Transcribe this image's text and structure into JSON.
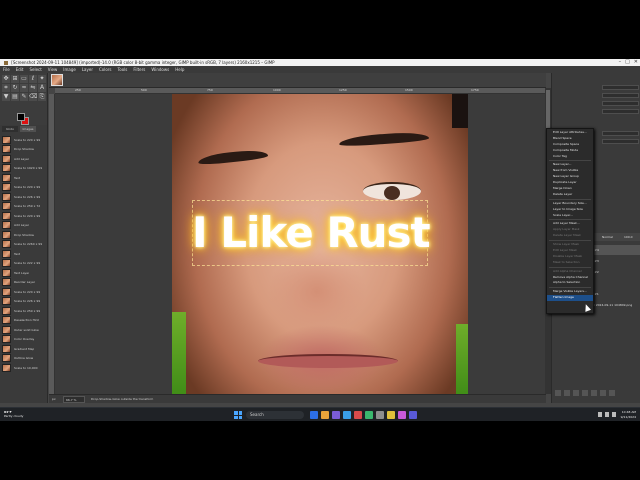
{
  "window": {
    "title": "[Screenshot 2024-09-11 104849] (imported)-14.0 (RGB color 8-bit gamma integer, GIMP built-in sRGB, 7 layers) 2160x1215 – GIMP"
  },
  "menubar": [
    "File",
    "Edit",
    "Select",
    "View",
    "Image",
    "Layer",
    "Colors",
    "Tools",
    "Filters",
    "Windows",
    "Help"
  ],
  "toolbox": {
    "tools": [
      "move-icon",
      "align-icon",
      "rect-select-icon",
      "free-select-icon",
      "fuzzy-select-icon",
      "crop-icon",
      "rotate-icon",
      "warp-icon",
      "flip-icon",
      "text-icon",
      "bucket-icon",
      "gradient-icon",
      "paintbrush-icon",
      "eraser-icon",
      "clone-icon"
    ],
    "tool_glyphs": [
      "✥",
      "⊞",
      "▭",
      "ℓ",
      "✦",
      "⌗",
      "↻",
      "≈",
      "⇋",
      "A",
      "▼",
      "▤",
      "✎",
      "⌫",
      "⎘"
    ],
    "fg_color": "#000000",
    "bg_color": "#dd1111"
  },
  "left_panel": {
    "tabs": [
      "Undo History",
      "Images"
    ],
    "history": [
      "Scale to 220 x 99",
      "Drop Shadow",
      "Add Layer",
      "Scale to 1920 x 99",
      "Text",
      "Scale to 220 x 99",
      "Scale to 226 x 99",
      "Scale to 259 x 72",
      "Scale to 220 x 99",
      "Add Layer",
      "Drop Shadow",
      "Scale to 2260 x 99",
      "Text",
      "Scale to 222 x 99",
      "Text Layer",
      "Reorder Layer",
      "Scale to 220 x 99",
      "Scale to 226 x 99",
      "Scale to 259 x 99",
      "Deselection Hint",
      "Outer solid Glow",
      "Color Overlay",
      "Gradient Map",
      "Outline Glow",
      "Scale to 10,000"
    ]
  },
  "canvas": {
    "ruler_ticks": [
      "250",
      "500",
      "750",
      "1000",
      "1250",
      "1500",
      "1750"
    ],
    "overlay_text": "I Like Rust"
  },
  "statusbar": {
    "unit": "px",
    "zoom": "66.7 %",
    "message": "Drop-Shadow-Glow outside the transform"
  },
  "context_menu": {
    "items": [
      {
        "label": "Edit Layer Attributes...",
        "disabled": false
      },
      {
        "label": "Blend Space",
        "disabled": false
      },
      {
        "label": "Composite Space",
        "disabled": false
      },
      {
        "label": "Composite Mode",
        "disabled": false
      },
      {
        "label": "Color Tag",
        "disabled": false
      },
      {
        "sep": true
      },
      {
        "label": "New Layer...",
        "disabled": false
      },
      {
        "label": "New from Visible",
        "disabled": false
      },
      {
        "label": "New Layer Group",
        "disabled": false
      },
      {
        "label": "Duplicate Layer",
        "disabled": false
      },
      {
        "label": "Merge Down",
        "disabled": false
      },
      {
        "label": "Delete Layer",
        "disabled": false
      },
      {
        "sep": true
      },
      {
        "label": "Layer Boundary Size...",
        "disabled": false
      },
      {
        "label": "Layer to Image Size",
        "disabled": false
      },
      {
        "label": "Scale Layer...",
        "disabled": false
      },
      {
        "sep": true
      },
      {
        "label": "Add Layer Mask...",
        "disabled": false
      },
      {
        "label": "Apply Layer Mask",
        "disabled": true
      },
      {
        "label": "Delete Layer Mask",
        "disabled": true
      },
      {
        "sep": true
      },
      {
        "label": "Show Layer Mask",
        "disabled": true
      },
      {
        "label": "Edit Layer Mask",
        "disabled": true
      },
      {
        "label": "Disable Layer Mask",
        "disabled": true
      },
      {
        "label": "Mask to Selection",
        "disabled": true
      },
      {
        "sep": true
      },
      {
        "label": "Add Alpha Channel",
        "disabled": true
      },
      {
        "label": "Remove Alpha Channel",
        "disabled": false
      },
      {
        "label": "Alpha to Selection",
        "disabled": false
      },
      {
        "sep": true
      },
      {
        "label": "Merge Visible Layers...",
        "disabled": false
      },
      {
        "label": "Flatten Image",
        "disabled": false,
        "highlighted": true
      }
    ]
  },
  "layers": {
    "rows": [
      {
        "name": "I Like Rust #4",
        "photo": false,
        "selected": true
      },
      {
        "name": "I Like Rust #3",
        "photo": false,
        "selected": false
      },
      {
        "name": "I Like Rust #2",
        "photo": false,
        "selected": false
      },
      {
        "name": "I Like Rust",
        "photo": false,
        "selected": false
      },
      {
        "name": "I Like Rust #1",
        "photo": false,
        "selected": false
      },
      {
        "name": "Screenshot 2024-09-11 104849.png",
        "photo": true,
        "selected": false
      }
    ],
    "mode": "Normal",
    "opacity": "100.0"
  },
  "taskbar": {
    "weather_temp": "84°F",
    "weather_desc": "Partly cloudy",
    "search_placeholder": "Search",
    "time": "10:48 AM",
    "date": "9/11/2024",
    "app_colors": [
      "#2c6ee6",
      "#e8a33a",
      "#7a5cd6",
      "#3aa0e8",
      "#d84b4b",
      "#3ab86e",
      "#8d8d8d",
      "#e0c03a",
      "#c85ad8",
      "#5a5ad8"
    ]
  }
}
